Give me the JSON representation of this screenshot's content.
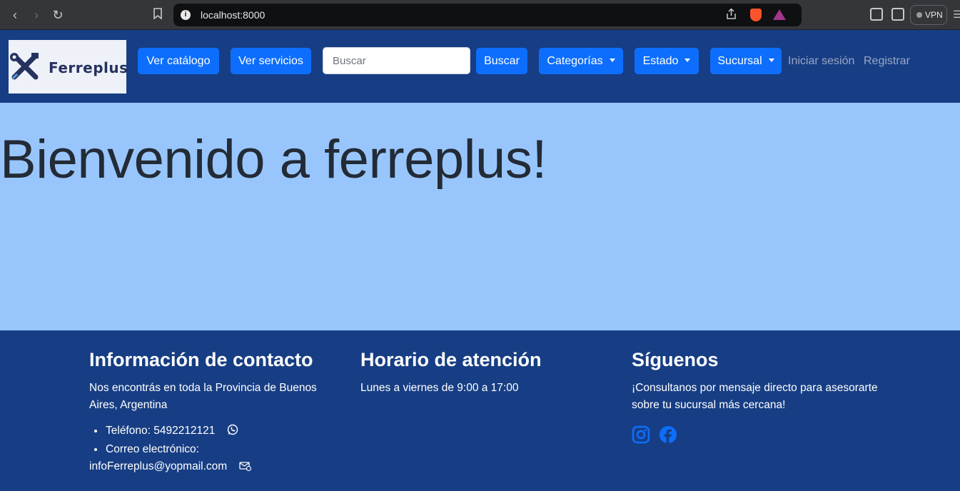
{
  "browser": {
    "url": "localhost:8000",
    "vpn_label": "VPN"
  },
  "navbar": {
    "logo_text": "Ferreplus",
    "buttons": {
      "catalog": "Ver catálogo",
      "services": "Ver servicios",
      "search": "Buscar",
      "categories": "Categorías",
      "status": "Estado",
      "branch": "Sucursal"
    },
    "search_placeholder": "Buscar",
    "links": {
      "login": "Iniciar sesión",
      "register": "Registrar"
    }
  },
  "hero": {
    "title": "Bienvenido a ferreplus!"
  },
  "footer": {
    "contact": {
      "title": "Información de contacto",
      "text": "Nos encontrás en toda la Provincia de Buenos Aires, Argentina",
      "phone": "Teléfono: 5492212121",
      "email_label": "Correo electrónico:",
      "email": "infoFerreplus@yopmail.com"
    },
    "hours": {
      "title": "Horario de atención",
      "text": "Lunes a viernes de 9:00 a 17:00"
    },
    "follow": {
      "title": "Síguenos",
      "text": "¡Consultanos por mensaje directo para asesorarte sobre tu sucursal más cercana!"
    }
  },
  "colors": {
    "navbar_bg": "#173e84",
    "hero_bg": "#98c6fc",
    "button_bg": "#0d6efd",
    "social_icon": "#0d6efd"
  }
}
